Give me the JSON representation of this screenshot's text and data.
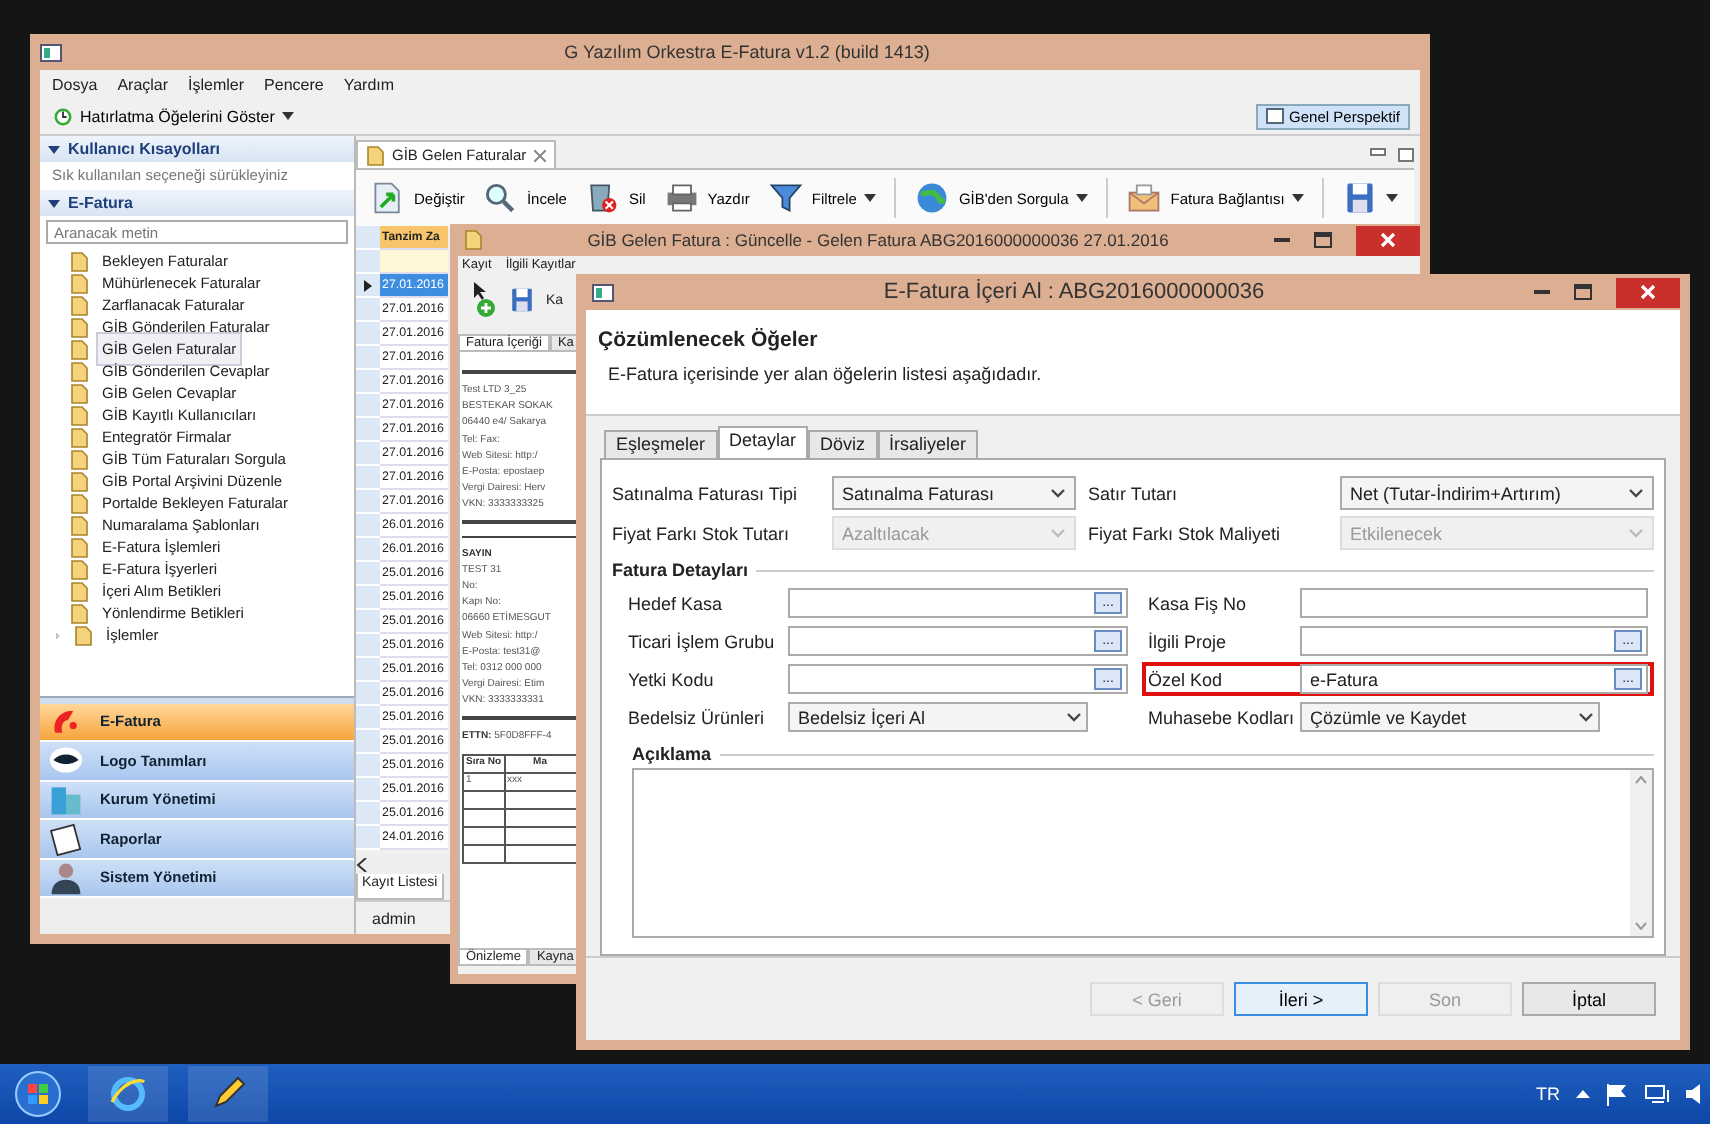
{
  "main_window": {
    "title": "G Yazılım Orkestra E-Fatura v1.2 (build 1413)",
    "menu": [
      "Dosya",
      "Araçlar",
      "İşlemler",
      "Pencere",
      "Yardım"
    ],
    "reminder_button": "Hatırlatma Öğelerini Göster",
    "perspective_button": "Genel Perspektif",
    "sidebar": {
      "shortcuts_header": "Kullanıcı Kısayolları",
      "shortcuts_hint": "Sık kullanılan seçeneği sürükleyiniz",
      "module_header": "E-Fatura",
      "search": {
        "placeholder": "Aranacak metin"
      },
      "items": [
        {
          "label": "Bekleyen Faturalar",
          "selected": false
        },
        {
          "label": "Mühürlenecek Faturalar",
          "selected": false
        },
        {
          "label": "Zarflanacak Faturalar",
          "selected": false
        },
        {
          "label": "GİB Gönderilen Faturalar",
          "selected": false
        },
        {
          "label": "GİB Gelen Faturalar",
          "selected": true
        },
        {
          "label": "GİB Gönderilen Cevaplar",
          "selected": false
        },
        {
          "label": "GİB Gelen Cevaplar",
          "selected": false
        },
        {
          "label": "GİB Kayıtlı Kullanıcıları",
          "selected": false
        },
        {
          "label": "Entegratör Firmalar",
          "selected": false
        },
        {
          "label": "GİB Tüm Faturaları Sorgula",
          "selected": false
        },
        {
          "label": "GİB Portal Arşivini Düzenle",
          "selected": false
        },
        {
          "label": "Portalde Bekleyen Faturalar",
          "selected": false
        },
        {
          "label": "Numaralama Şablonları",
          "selected": false
        },
        {
          "label": "E-Fatura İşlemleri",
          "selected": false
        },
        {
          "label": "E-Fatura İşyerleri",
          "selected": false
        },
        {
          "label": "İçeri Alım Betikleri",
          "selected": false
        },
        {
          "label": "Yönlendirme Betikleri",
          "selected": false
        },
        {
          "label": "İşlemler",
          "selected": false,
          "expanded": false
        }
      ],
      "sections": [
        {
          "label": "E-Fatura",
          "selected": true
        },
        {
          "label": "Logo Tanımları",
          "selected": false
        },
        {
          "label": "Kurum Yönetimi",
          "selected": false
        },
        {
          "label": "Raporlar",
          "selected": false
        },
        {
          "label": "Sistem Yönetimi",
          "selected": false
        }
      ]
    },
    "editor_tab": "GİB Gelen Faturalar",
    "toolbar": [
      {
        "label": "Değiştir",
        "dropdown": false
      },
      {
        "label": "İncele",
        "dropdown": false
      },
      {
        "label": "Sil",
        "dropdown": false
      },
      {
        "label": "Yazdır",
        "dropdown": false
      },
      {
        "label": "Filtrele",
        "dropdown": true
      },
      {
        "label": "GİB'den Sorgula",
        "dropdown": true
      },
      {
        "label": "Fatura Bağlantısı",
        "dropdown": true
      },
      {
        "dropdown": true
      }
    ],
    "table": {
      "columns": [
        "Tanzim Za"
      ],
      "rows": [
        {
          "cells": [
            "27.01.2016"
          ],
          "selected": true
        },
        {
          "cells": [
            "27.01.2016"
          ],
          "selected": false
        },
        {
          "cells": [
            "27.01.2016"
          ],
          "selected": false
        },
        {
          "cells": [
            "27.01.2016"
          ],
          "selected": false
        },
        {
          "cells": [
            "27.01.2016"
          ],
          "selected": false
        },
        {
          "cells": [
            "27.01.2016"
          ],
          "selected": false
        },
        {
          "cells": [
            "27.01.2016"
          ],
          "selected": false
        },
        {
          "cells": [
            "27.01.2016"
          ],
          "selected": false
        },
        {
          "cells": [
            "27.01.2016"
          ],
          "selected": false
        },
        {
          "cells": [
            "27.01.2016"
          ],
          "selected": false
        },
        {
          "cells": [
            "26.01.2016"
          ],
          "selected": false
        },
        {
          "cells": [
            "26.01.2016"
          ],
          "selected": false
        },
        {
          "cells": [
            "25.01.2016"
          ],
          "selected": false
        },
        {
          "cells": [
            "25.01.2016"
          ],
          "selected": false
        },
        {
          "cells": [
            "25.01.2016"
          ],
          "selected": false
        },
        {
          "cells": [
            "25.01.2016"
          ],
          "selected": false
        },
        {
          "cells": [
            "25.01.2016"
          ],
          "selected": false
        },
        {
          "cells": [
            "25.01.2016"
          ],
          "selected": false
        },
        {
          "cells": [
            "25.01.2016"
          ],
          "selected": false
        },
        {
          "cells": [
            "25.01.2016"
          ],
          "selected": false
        },
        {
          "cells": [
            "25.01.2016"
          ],
          "selected": false
        },
        {
          "cells": [
            "25.01.2016"
          ],
          "selected": false
        },
        {
          "cells": [
            "25.01.2016"
          ],
          "selected": false
        },
        {
          "cells": [
            "24.01.2016"
          ],
          "selected": false
        }
      ]
    },
    "bottom_tabs": [
      "Kayıt Listesi"
    ],
    "status_bar": "admin"
  },
  "detail_window": {
    "title": "GİB Gelen Fatura : Güncelle - Gelen Fatura ABG2016000000036 27.01.2016",
    "menu": [
      "Kayıt",
      "İlgili Kayıtlar"
    ],
    "toolbar_label": "Ka",
    "tabs": [
      {
        "label": "Fatura İçeriği",
        "selected": true
      },
      {
        "label": "Ka",
        "selected": false
      }
    ],
    "preview": {
      "sender": [
        "Test LTD 3_25",
        "BESTEKAR SOKAK",
        "06440 e4/ Sakarya",
        "Tel: Fax:",
        "Web Sitesi: http:/",
        "E-Posta: epostaep",
        "Vergi Dairesi: Herv",
        "VKN: 3333333325"
      ],
      "recipient_heading": "SAYIN",
      "recipient": [
        "TEST 31",
        "No:",
        "Kapı No:",
        "06660 ETİMESGUT",
        "Web Sitesi: http:/",
        "E-Posta: test31@",
        "Tel: 0312 000 000",
        "Vergi Dairesi: Etim",
        "VKN: 3333333331"
      ],
      "ettn_label": "ETTN:",
      "ettn_value": "5F0D8FFF-4",
      "table": {
        "columns": [
          "Sıra No",
          "Ma"
        ],
        "rows": [
          [
            "1",
            "xxx"
          ]
        ]
      }
    },
    "bottom_tabs": [
      {
        "label": "Önizleme",
        "selected": true
      },
      {
        "label": "Kayna",
        "selected": false
      }
    ]
  },
  "dialog": {
    "title": "E-Fatura İçeri Al : ABG2016000000036",
    "heading": "Çözümlenecek Öğeler",
    "description": "E-Fatura içerisinde yer alan öğelerin listesi aşağıdadır.",
    "tabs": [
      {
        "label": "Eşleşmeler",
        "selected": false
      },
      {
        "label": "Detaylar",
        "selected": true
      },
      {
        "label": "Döviz",
        "selected": false
      },
      {
        "label": "İrsaliyeler",
        "selected": false
      }
    ],
    "top_fields": [
      {
        "label": "Satınalma Faturası Tipi",
        "value": "Satınalma Faturası",
        "disabled": false
      },
      {
        "label": "Satır Tutarı",
        "value": "Net (Tutar-İndirim+Artırım)",
        "disabled": false
      },
      {
        "label": "Fiyat Farkı Stok Tutarı",
        "value": "Azaltılacak",
        "disabled": true
      },
      {
        "label": "Fiyat Farkı Stok Maliyeti",
        "value": "Etkilenecek",
        "disabled": true
      }
    ],
    "group_title": "Fatura Detayları",
    "detail_fields": [
      {
        "label": "Hedef Kasa",
        "kind": "lookup",
        "button": "...",
        "highlighted": false
      },
      {
        "label": "Kasa Fiş No",
        "kind": "text",
        "highlighted": false
      },
      {
        "label": "Ticari İşlem Grubu",
        "kind": "lookup",
        "button": "...",
        "highlighted": false
      },
      {
        "label": "İlgili Proje",
        "kind": "lookup",
        "button": "...",
        "highlighted": false
      },
      {
        "label": "Yetki Kodu",
        "kind": "lookup",
        "button": "...",
        "highlighted": false
      },
      {
        "label": "Özel Kod",
        "kind": "lookup",
        "value": "e-Fatura",
        "button": "...",
        "highlighted": true
      },
      {
        "label": "Bedelsiz Ürünleri",
        "kind": "select",
        "value": "Bedelsiz İçeri Al",
        "highlighted": false
      },
      {
        "label": "Muhasebe Kodları",
        "kind": "select",
        "value": "Çözümle ve Kaydet",
        "highlighted": false
      }
    ],
    "notes_label": "Açıklama",
    "buttons": [
      {
        "label": "< Geri",
        "disabled": true,
        "default": false
      },
      {
        "label": "İleri >",
        "disabled": false,
        "default": true
      },
      {
        "label": "Son",
        "disabled": true,
        "default": false
      },
      {
        "label": "İptal",
        "disabled": false,
        "default": false
      }
    ]
  },
  "taskbar": {
    "language": "TR"
  }
}
